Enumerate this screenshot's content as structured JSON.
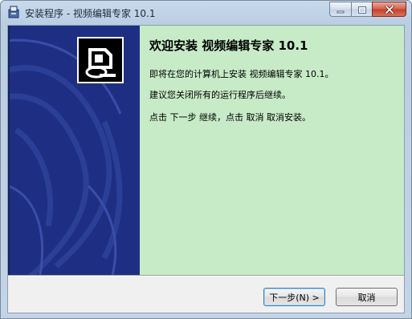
{
  "window": {
    "title": "安装程序 - 视频编辑专家 10.1",
    "app_icon": "installer-icon",
    "caption_buttons": [
      "minimize-icon",
      "maximize-icon",
      "close-icon"
    ]
  },
  "side_panel": {
    "logo_icon": "install-computer-icon",
    "background_color": "#1e2f83"
  },
  "content": {
    "title": "欢迎安装 视频编辑专家 10.1",
    "paragraphs": [
      "即将在您的计算机上安装 视频编辑专家 10.1。",
      "建议您关闭所有的运行程序后继续。",
      "点击 下一步 继续，点击 取消 取消安装。"
    ],
    "background_color": "#c7ebc7"
  },
  "buttons": {
    "next_label": "下一步(N) >",
    "cancel_label": "取消"
  }
}
